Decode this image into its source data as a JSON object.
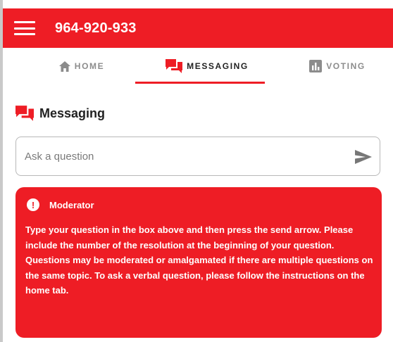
{
  "header": {
    "title": "964-920-933",
    "menu_icon": "hamburger-menu-icon"
  },
  "tabs": [
    {
      "label": "HOME",
      "icon": "home-icon",
      "active": false
    },
    {
      "label": "MESSAGING",
      "icon": "chat-bubbles-icon",
      "active": true
    },
    {
      "label": "VOTING",
      "icon": "bar-chart-icon",
      "active": false
    }
  ],
  "messaging": {
    "title": "Messaging",
    "icon": "chat-bubbles-icon",
    "input": {
      "value": "",
      "placeholder": "Ask a question"
    },
    "send_icon": "send-arrow-icon"
  },
  "notice": {
    "icon": "exclamation-icon",
    "title": "Moderator",
    "body": "Type your question in the box above and then press the send arrow. Please include the number of the resolution at the beginning of your question. Questions may be moderated or amalgamated if there are multiple questions on the same topic. To ask a verbal question, please follow the instructions on the home tab."
  },
  "colors": {
    "accent": "#ee1d25",
    "inactive_tab": "#8c8c8c",
    "text": "#222222"
  }
}
